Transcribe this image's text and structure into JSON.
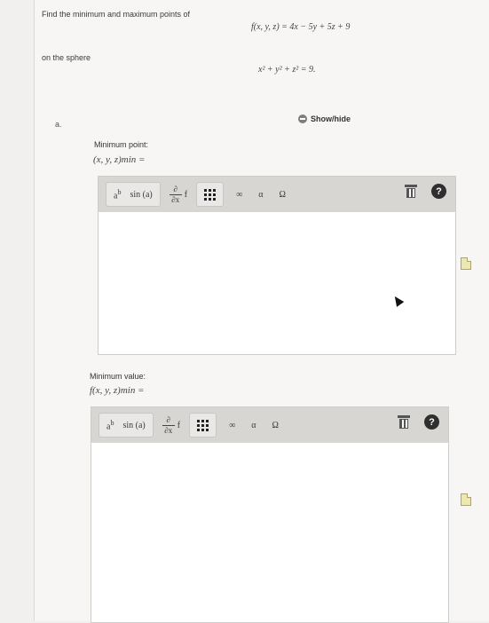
{
  "question": {
    "prompt": "Find the minimum and maximum points of",
    "function": "f(x, y, z) = 4x − 5y + 5z + 9",
    "constraint_intro": "on the sphere",
    "constraint": "x² + y² + z² = 9."
  },
  "part": {
    "label": "a.",
    "show_hide_label": "Show/hide"
  },
  "answers": [
    {
      "label": "Minimum point:",
      "expr": "(x, y, z)min ="
    },
    {
      "label": "Minimum value:",
      "expr": "f(x, y, z)min ="
    }
  ],
  "toolbar": {
    "power_label": "a",
    "power_sup": "b",
    "sin_label": "sin (a)",
    "deriv_top": "∂",
    "deriv_bottom": "∂x",
    "deriv_f": "f",
    "infinity_label": "∞",
    "alpha_label": "α",
    "omega_label": "Ω",
    "help_label": "?"
  }
}
